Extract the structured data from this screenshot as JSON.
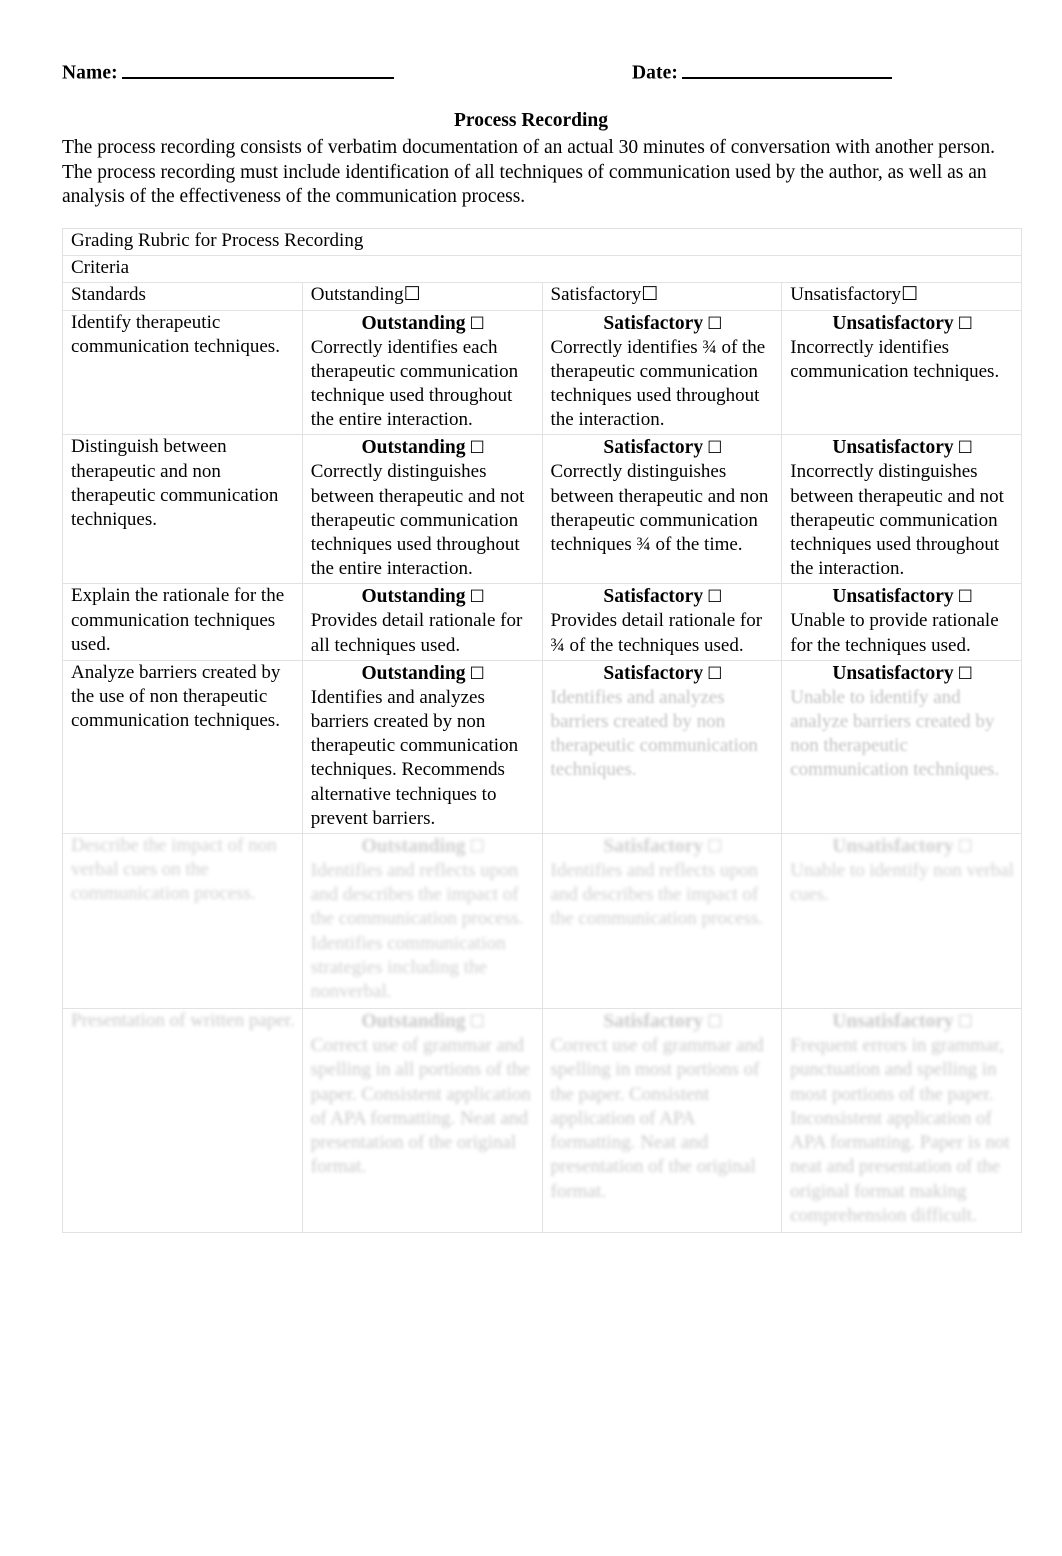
{
  "header": {
    "name_label": "Name:",
    "date_label": "Date:"
  },
  "document": {
    "title": "Process Recording",
    "intro": "The process recording consists of verbatim documentation of an actual 30 minutes of conversation with another person.  The process recording must include identification of all techniques of communication used by the author, as well as an analysis of the effectiveness of the communication process."
  },
  "table": {
    "title": "Grading Rubric for Process Recording",
    "subtitle": "Criteria",
    "columns": [
      "Standards",
      "Outstanding",
      "Satisfactory",
      "Unsatisfactory"
    ],
    "checkbox_glyph": "☐",
    "rating_labels": {
      "outstanding": "Outstanding",
      "satisfactory": "Satisfactory",
      "unsatisfactory": "Unsatisfactory"
    },
    "rows": [
      {
        "standard": "Identify therapeutic communication techniques.",
        "outstanding": "Correctly identifies each therapeutic communication technique used throughout the entire interaction.",
        "satisfactory": "Correctly identifies ¾ of the therapeutic communication techniques used throughout the interaction.",
        "unsatisfactory": "Incorrectly identifies communication techniques.",
        "legibility": {
          "standard": "clear",
          "outstanding": "clear",
          "satisfactory": "clear",
          "unsatisfactory": "clear"
        }
      },
      {
        "standard": "Distinguish between therapeutic and non therapeutic communication techniques.",
        "outstanding": "Correctly distinguishes between therapeutic and not therapeutic communication techniques used throughout the entire interaction.",
        "satisfactory": "Correctly distinguishes between therapeutic and non therapeutic communication techniques ¾ of the time.",
        "unsatisfactory": "Incorrectly distinguishes between therapeutic and not therapeutic communication techniques used throughout the interaction.",
        "legibility": {
          "standard": "clear",
          "outstanding": "clear",
          "satisfactory": "clear",
          "unsatisfactory": "clear"
        }
      },
      {
        "standard": "Explain the rationale for the communication techniques used.",
        "outstanding": "Provides detail rationale for all techniques used.",
        "satisfactory": "Provides detail rationale for ¾ of the techniques used.",
        "unsatisfactory": "Unable to provide rationale for the techniques used.",
        "legibility": {
          "standard": "clear",
          "outstanding": "clear",
          "satisfactory": "clear",
          "unsatisfactory": "clear"
        }
      },
      {
        "standard": "Analyze barriers created by the use of non therapeutic communication techniques.",
        "outstanding": "Identifies and analyzes barriers created by non therapeutic communication techniques.  Recommends alternative techniques to prevent barriers.",
        "satisfactory": "Identifies and analyzes barriers created by non therapeutic communication techniques.",
        "unsatisfactory": "Unable to identify and analyze barriers created by non therapeutic communication techniques.",
        "legibility": {
          "standard": "clear",
          "outstanding": "clear",
          "satisfactory": "blurred",
          "unsatisfactory": "blurred"
        }
      },
      {
        "standard": "Describe the impact of non verbal cues on the communication process.",
        "outstanding": "Identifies and reflects upon and describes the impact of the communication process.  Identifies communication strategies including the nonverbal.",
        "satisfactory": "Identifies and reflects upon and describes the impact of the communication process.",
        "unsatisfactory": "Unable to identify non verbal cues.",
        "legibility": {
          "standard": "blurred",
          "outstanding": "blurred",
          "satisfactory": "blurred",
          "unsatisfactory": "blurred"
        }
      },
      {
        "standard": "Presentation of written paper.",
        "outstanding": "Correct use of grammar and spelling in all portions of the paper.  Consistent application of APA formatting.  Neat and presentation of the original format.",
        "satisfactory": "Correct use of grammar and spelling in most portions of the paper.  Consistent application of APA formatting.  Neat and presentation of the original format.",
        "unsatisfactory": "Frequent errors in grammar, punctuation and spelling in most portions of the paper.  Inconsistent application of APA formatting.  Paper is not neat and presentation of the original format making comprehension difficult.",
        "legibility": {
          "standard": "blurred",
          "outstanding": "blurred",
          "satisfactory": "blurred",
          "unsatisfactory": "blurred"
        }
      }
    ]
  }
}
